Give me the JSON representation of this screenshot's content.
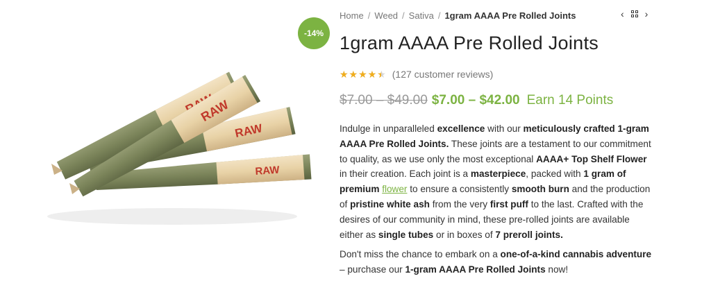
{
  "badge": {
    "sale": "-14%"
  },
  "breadcrumb": {
    "items": [
      "Home",
      "Weed",
      "Sativa"
    ],
    "current": "1gram AAAA Pre Rolled Joints"
  },
  "nav": {
    "prev_icon": "‹",
    "next_icon": "›"
  },
  "product": {
    "title": "1gram AAAA Pre Rolled Joints",
    "rating_fraction": 0.88,
    "reviews": "(127 customer reviews)",
    "price_old": "$7.00 – $49.00",
    "price_new": "$7.00 – $42.00",
    "points": "Earn 14 Points"
  },
  "description": {
    "p1": [
      "Indulge in unparalleled ",
      "excellence",
      " with our ",
      "meticulously crafted 1-gram AAAA Pre Rolled Joints.",
      " These joints are a testament to our commitment to quality, as we use only the most exceptional ",
      "AAAA+ Top Shelf Flower",
      " in their creation. Each joint is a ",
      "masterpiece",
      ", packed with ",
      "1 gram of premium ",
      "flower",
      " to ensure a consistently ",
      "smooth burn",
      " and the production of ",
      "pristine white ash",
      " from the very ",
      "first puff",
      " to the last. Crafted with the desires of our community in mind, these pre-rolled joints are available either as ",
      "single tubes",
      " or in boxes of ",
      "7 preroll joints."
    ],
    "p2": [
      "Don't miss the chance to embark on a ",
      "one-of-a-kind cannabis adventure",
      " – purchase our ",
      "1-gram AAAA Pre Rolled Joints",
      " now!"
    ]
  },
  "image_text": {
    "brand": "RAW"
  },
  "colors": {
    "accent": "#7cb342",
    "star": "#f0ad1c"
  }
}
